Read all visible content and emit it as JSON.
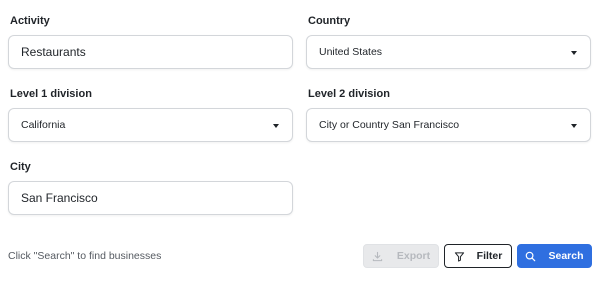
{
  "form": {
    "activity": {
      "label": "Activity",
      "value": "Restaurants"
    },
    "country": {
      "label": "Country",
      "value": "United States"
    },
    "level1": {
      "label": "Level 1 division",
      "value": "California"
    },
    "level2": {
      "label": "Level 2 division",
      "value": "City or Country San Francisco"
    },
    "city": {
      "label": "City",
      "value": "San Francisco"
    }
  },
  "footer": {
    "hint": "Click \"Search\" to find businesses",
    "export_label": "Export",
    "filter_label": "Filter",
    "search_label": "Search"
  },
  "colors": {
    "primary": "#2f6fe0",
    "disabled_bg": "#e8e9eb",
    "border": "#d3d6da"
  },
  "icons": {
    "export": "download-icon",
    "filter": "filter-icon",
    "search": "search-icon",
    "dropdown": "caret-down-icon"
  }
}
